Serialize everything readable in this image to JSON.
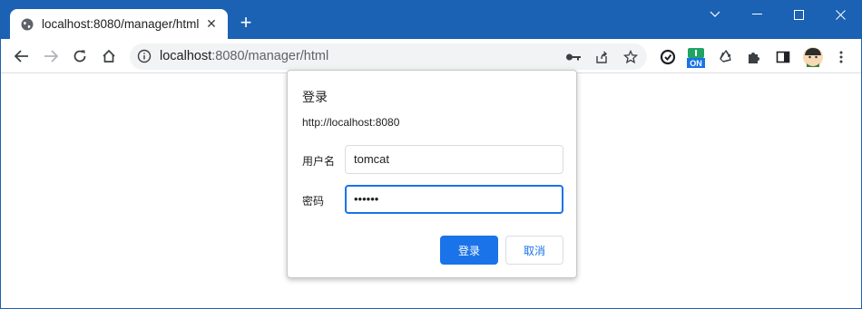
{
  "tab": {
    "title": "localhost:8080/manager/html",
    "close_glyph": "✕",
    "icon": "globe-icon"
  },
  "newtab": {
    "glyph": "+"
  },
  "toolbar": {
    "url_host": "localhost",
    "url_rest": ":8080/manager/html"
  },
  "extensions": {
    "on_badge": "ON"
  },
  "dialog": {
    "title": "登录",
    "origin": "http://localhost:8080",
    "username_label": "用户名",
    "username_value": "tomcat",
    "password_label": "密码",
    "password_value": "••••••",
    "login_button": "登录",
    "cancel_button": "取消"
  },
  "colors": {
    "titlebar": "#1b61b4",
    "accent": "#1a73e8"
  }
}
